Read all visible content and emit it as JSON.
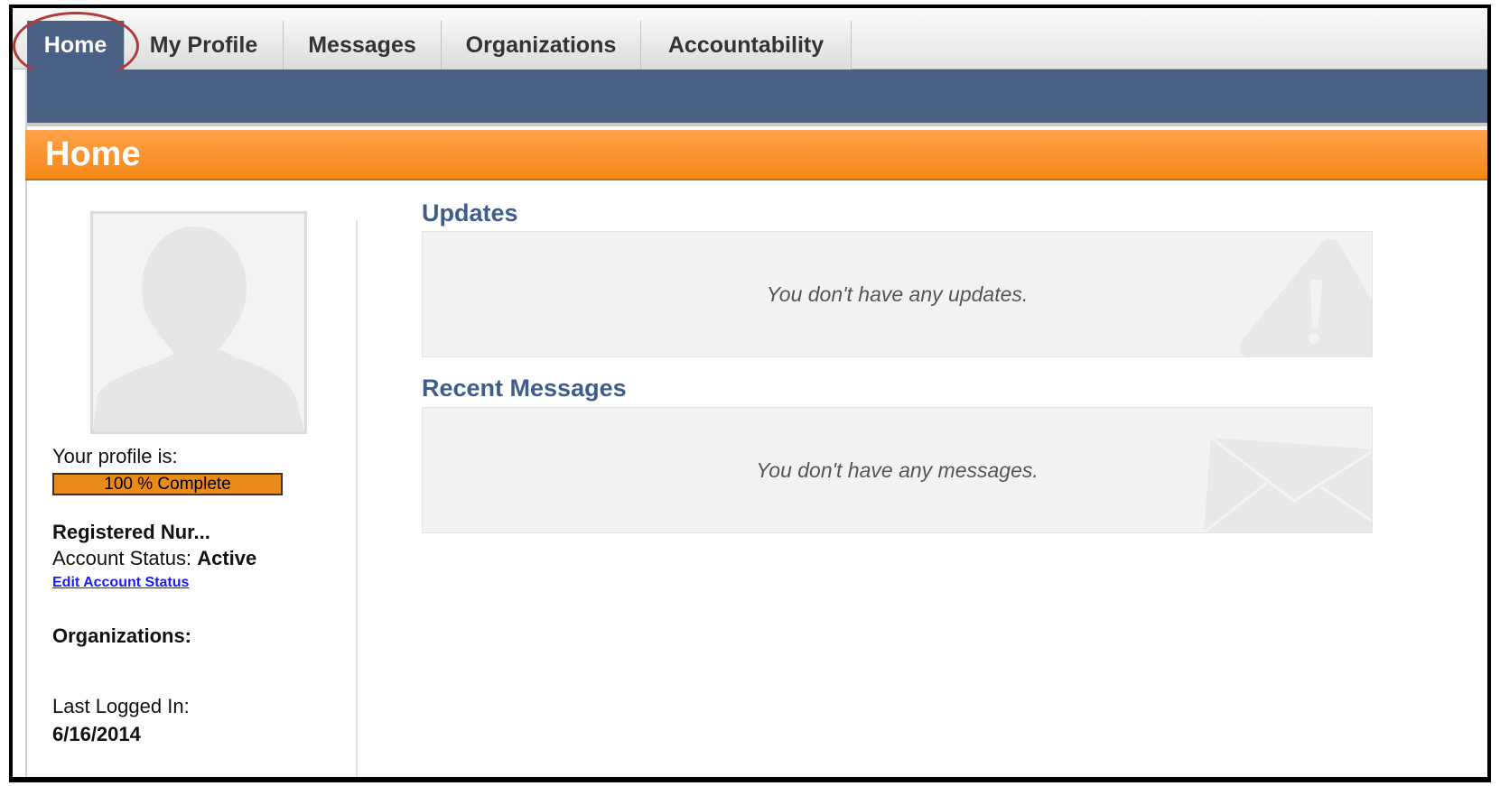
{
  "nav": {
    "tabs": [
      {
        "label": "Home",
        "active": true
      },
      {
        "label": "My Profile",
        "active": false
      },
      {
        "label": "Messages",
        "active": false
      },
      {
        "label": "Organizations",
        "active": false
      },
      {
        "label": "Accountability",
        "active": false
      }
    ]
  },
  "page": {
    "title": "Home"
  },
  "sidebar": {
    "profile_label": "Your profile is:",
    "profile_complete_text": "100 % Complete",
    "profile_complete_fraction": 1.0,
    "role": "Registered Nur...",
    "account_status_label": "Account Status:",
    "account_status_value": "Active",
    "edit_status_link": "Edit Account Status",
    "organizations_label": "Organizations:",
    "last_login_label": "Last Logged In:",
    "last_login_value": "6/16/2014"
  },
  "main": {
    "updates": {
      "heading": "Updates",
      "empty_text": "You don't have any updates.",
      "icon": "warning-icon"
    },
    "messages": {
      "heading": "Recent Messages",
      "empty_text": "You don't have any messages.",
      "icon": "envelope-icon"
    }
  },
  "colors": {
    "nav_blue": "#4a6085",
    "title_orange": "#f58716",
    "heading_blue": "#3f5d8a",
    "link_blue": "#1a1aff",
    "highlight_red": "#b33a3a"
  }
}
